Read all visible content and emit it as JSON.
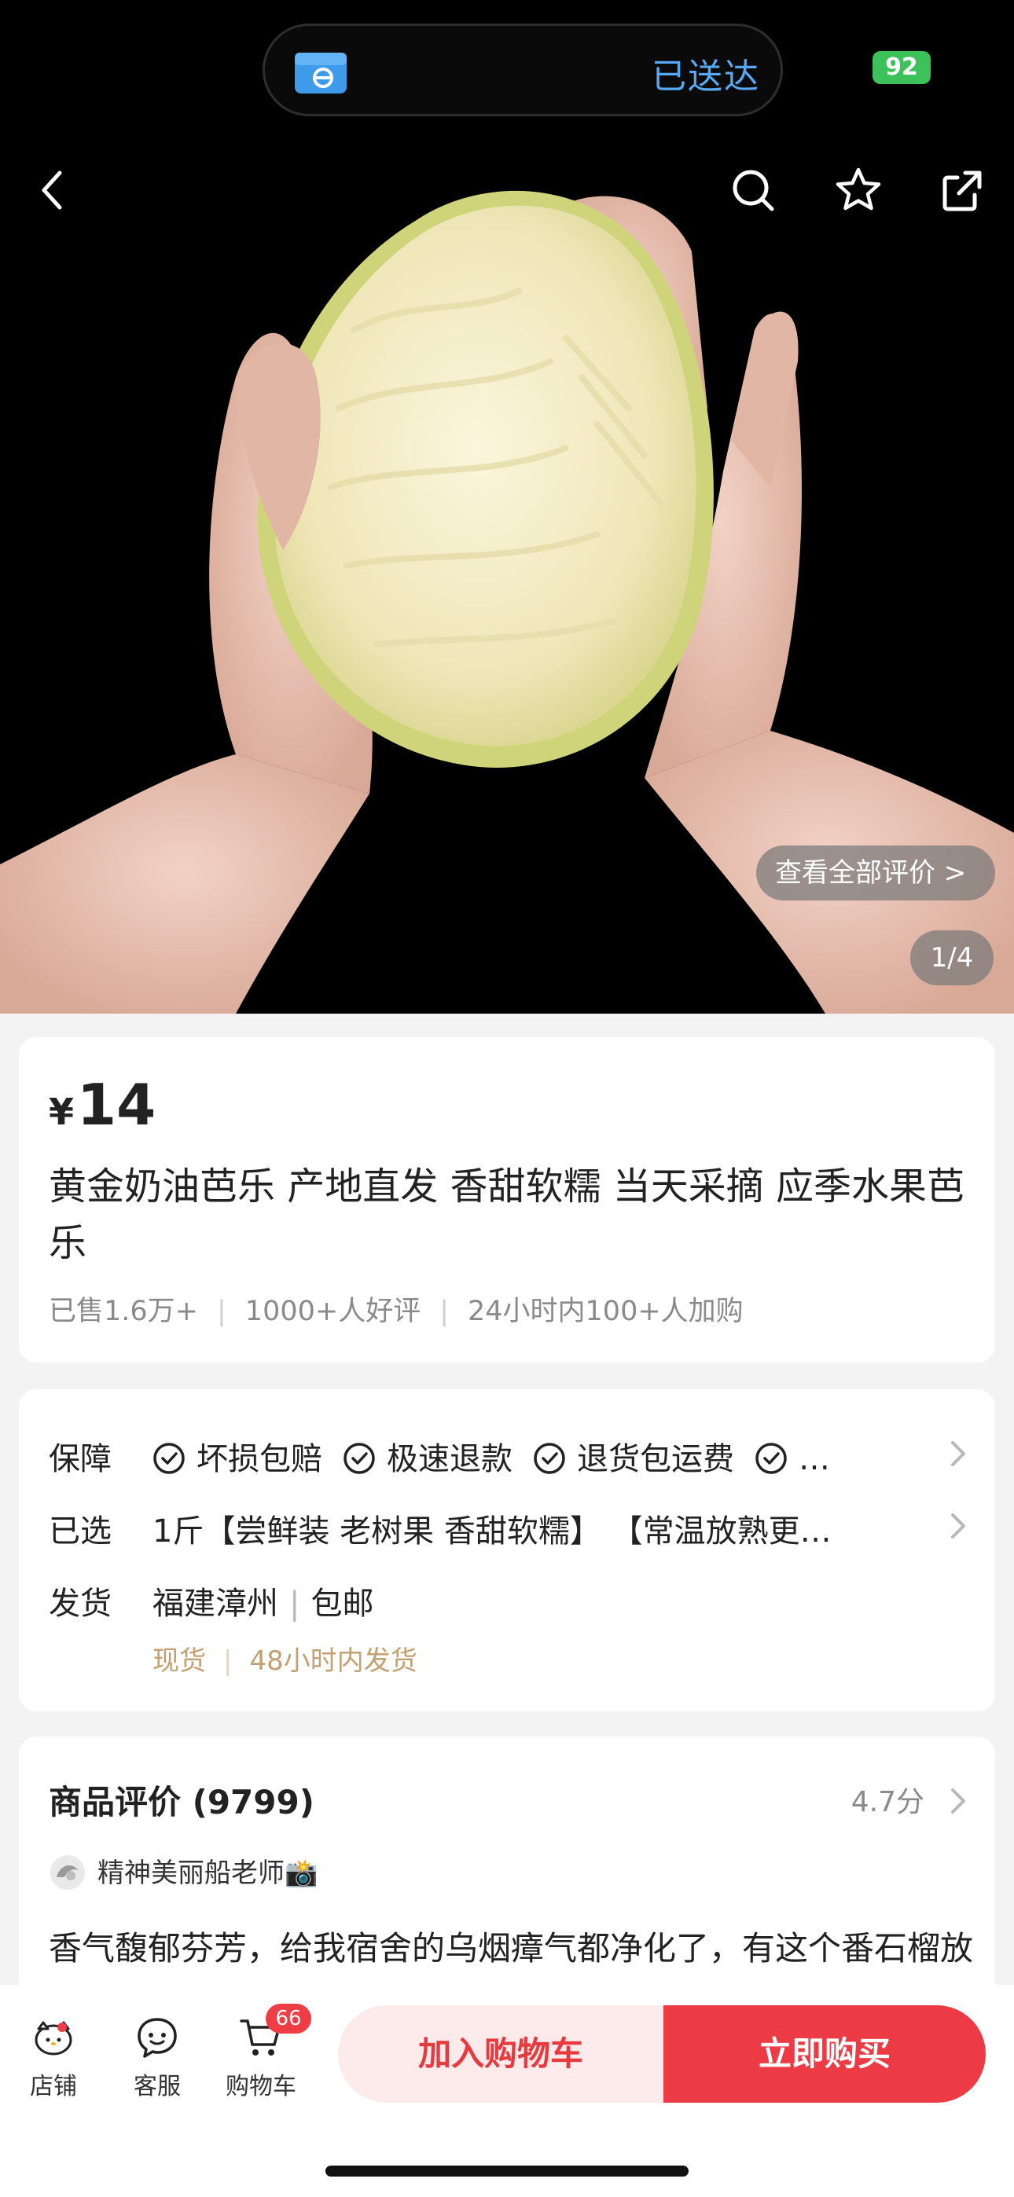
{
  "status_bar": {
    "island_icon": "delivery-box-icon",
    "island_text": "已送达",
    "battery": "92"
  },
  "gallery": {
    "review_link": "查看全部评价 >",
    "page_indicator": "1/4"
  },
  "product": {
    "price_symbol": "¥",
    "price": "14",
    "title": "黄金奶油芭乐 产地直发 香甜软糯 当天采摘 应季水果芭乐",
    "stats": [
      "已售1.6万+",
      "1000+人好评",
      "24小时内100+人加购"
    ]
  },
  "service": {
    "guarantee_label": "保障",
    "guarantees": [
      "坏损包赔",
      "极速退款",
      "退货包运费",
      "…"
    ],
    "selected_label": "已选",
    "selected_value": "1斤【尝鲜装 老树果 香甜软糯】 【常温放熟更…",
    "ship_label": "发货",
    "ship_origin": "福建漳州",
    "ship_fee": "包邮",
    "ship_sub": [
      "现货",
      "48小时内发货"
    ]
  },
  "reviews": {
    "title": "商品评价 (9799)",
    "score": "4.7分",
    "reviewer_name": "精神美丽船老师📸",
    "text": "香气馥郁芬芳，给我宿舍的乌烟瘴气都净化了，有这个番石榴放在床边睡觉感觉嘴巴的空气都不复存在了，果子很饱，大"
  },
  "bottom_bar": {
    "store_label": "店铺",
    "service_label": "客服",
    "cart_label": "购物车",
    "cart_badge": "66",
    "add_to_cart": "加入购物车",
    "buy_now": "立即购买"
  }
}
